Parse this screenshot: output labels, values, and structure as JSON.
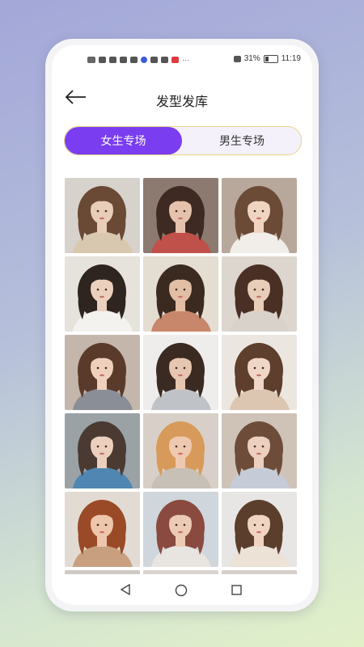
{
  "status_bar": {
    "battery_text": "31%",
    "time": "11:19"
  },
  "header": {
    "title": "发型发库"
  },
  "tabs": [
    {
      "label": "女生专场",
      "active": true
    },
    {
      "label": "男生专场",
      "active": false
    }
  ],
  "colors": {
    "accent": "#7a3ef0",
    "segment_border": "#e8d48e",
    "segment_bg": "#f4f1fb"
  },
  "gallery": {
    "items": [
      {
        "name": "updo-back-view",
        "bg": "#d8d2cc",
        "hair": "#6a4a35",
        "skin": "#e8cdb8",
        "top": "#d9c8b0"
      },
      {
        "name": "long-wavy-bangs",
        "bg": "#8c7a70",
        "hair": "#3e2a22",
        "skin": "#e6c2ac",
        "top": "#c0504a"
      },
      {
        "name": "shoulder-bob-bangs",
        "bg": "#b8a89c",
        "hair": "#6b4a36",
        "skin": "#efd4c2",
        "top": "#f1ede8"
      },
      {
        "name": "long-curly-dark",
        "bg": "#e6e2dc",
        "hair": "#2e2420",
        "skin": "#ecd0be",
        "top": "#f4f2ee"
      },
      {
        "name": "long-wavy-brown",
        "bg": "#e4ddd2",
        "hair": "#3b2a20",
        "skin": "#e2bea4",
        "top": "#c8876a"
      },
      {
        "name": "curly-back-view",
        "bg": "#dcd6ce",
        "hair": "#4a3024",
        "skin": "#e8cdb8",
        "top": "#d8d2ca"
      },
      {
        "name": "wavy-fringe-plaid",
        "bg": "#c4b6aa",
        "hair": "#5a3a2a",
        "skin": "#efd0bc",
        "top": "#8a8e96"
      },
      {
        "name": "long-side-part",
        "bg": "#efedeb",
        "hair": "#3a2a22",
        "skin": "#e6c6b0",
        "top": "#bfc2c6"
      },
      {
        "name": "medium-wavy-bangs",
        "bg": "#ece6e0",
        "hair": "#5e3e2c",
        "skin": "#f0d6c6",
        "top": "#dcc6b2"
      },
      {
        "name": "short-blue-sweater",
        "bg": "#9aa2a6",
        "hair": "#4a3a32",
        "skin": "#eccfbd",
        "top": "#4f86b2"
      },
      {
        "name": "blonde-low-bun",
        "bg": "#d8d0c8",
        "hair": "#d89a5a",
        "skin": "#eec9b0",
        "top": "#c7c0b6"
      },
      {
        "name": "curly-bob-plaid",
        "bg": "#cfc3b8",
        "hair": "#6e4c3a",
        "skin": "#eccfbe",
        "top": "#c5ccd8"
      },
      {
        "name": "auburn-bob",
        "bg": "#e2dbd4",
        "hair": "#9a4a26",
        "skin": "#eec6ac",
        "top": "#c8a080"
      },
      {
        "name": "rose-updo",
        "bg": "#cfd6dc",
        "hair": "#8a4a40",
        "skin": "#eccab4",
        "top": "#e8e4e0"
      },
      {
        "name": "bob-with-bangs",
        "bg": "#e8e6e4",
        "hair": "#5c3e2c",
        "skin": "#f0d4c2",
        "top": "#ece2d6"
      },
      {
        "name": "partial-row-1",
        "bg": "#cfc9c4",
        "hair": "#4a3428",
        "skin": "#e8cdb8",
        "top": "#d0c8c0"
      },
      {
        "name": "partial-row-2",
        "bg": "#d9d4d0",
        "hair": "#5a3c2c",
        "skin": "#e8cdb8",
        "top": "#d6d0ca"
      },
      {
        "name": "partial-row-3",
        "bg": "#d4cfca",
        "hair": "#3e2e26",
        "skin": "#e8cdb8",
        "top": "#cac4be"
      }
    ]
  }
}
